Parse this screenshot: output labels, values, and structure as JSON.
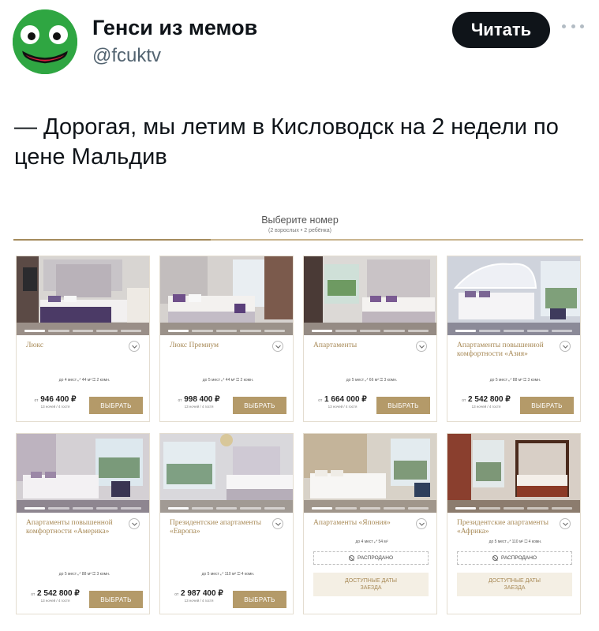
{
  "post": {
    "author_name": "Генси из мемов",
    "author_handle": "@fcuktv",
    "follow_label": "Читать",
    "text": "— Дорогая, мы летим в Кисловодск на 2 недели по цене Мальдив"
  },
  "booking": {
    "title": "Выберите номер",
    "subtitle": "(2 взрослых • 2 ребёнка)",
    "select_label": "ВЫБРАТЬ",
    "sold_out_label": "РАСПРОДАНО",
    "dates_label_1": "ДОСТУПНЫЕ ДАТЫ",
    "dates_label_2": "ЗАЕЗДА",
    "rooms": [
      {
        "name": "Люкс",
        "features": "до 4 мест   ⤢ 44 м²   ◫ 2 комн.",
        "price": "946 400",
        "price_prefix": "от",
        "currency": "₽",
        "nights": "13 ночей / 4 гостя"
      },
      {
        "name": "Люкс Премиум",
        "features": "до 5 мест   ⤢ 44 м²   ◫ 2 комн.",
        "price": "998 400",
        "price_prefix": "от",
        "currency": "₽",
        "nights": "13 ночей / 4 гостя"
      },
      {
        "name": "Апартаменты",
        "features": "до 5 мест   ⤢ 66 м²   ◫ 3 комн.",
        "price": "1 664 000",
        "price_prefix": "от",
        "currency": "₽",
        "nights": "13 ночей / 4 гостя"
      },
      {
        "name": "Апартаменты повышенной комфортности «Азия»",
        "features": "до 5 мест   ⤢ 88 м²   ◫ 3 комн.",
        "price": "2 542 800",
        "price_prefix": "от",
        "currency": "₽",
        "nights": "13 ночей / 4 гостя"
      },
      {
        "name": "Апартаменты повышенной комфортности «Америка»",
        "features": "до 5 мест   ⤢ 88 м²   ◫ 3 комн.",
        "price": "2 542 800",
        "price_prefix": "от",
        "currency": "₽",
        "nights": "13 ночей / 4 гостя"
      },
      {
        "name": "Президентские апартаменты «Европа»",
        "features": "до 5 мест   ⤢ 110 м²   ◫ 4 комн.",
        "price": "2 987 400",
        "price_prefix": "от",
        "currency": "₽",
        "nights": "13 ночей / 4 гостя"
      },
      {
        "name": "Апартаменты «Япония»",
        "features": "до 4 мест   ⤢ 54 м²"
      },
      {
        "name": "Президентские апартаменты «Африка»",
        "features": "до 5 мест   ⤢ 110 м²   ◫ 4 комн."
      }
    ]
  },
  "colors": {
    "accent_gold": "#b49a69",
    "text_gold": "#a88a57",
    "avatar_green": "#2fa642",
    "follow_button": "#0f1419"
  },
  "icons": [
    "frog-face-avatar",
    "more-dots-icon",
    "chevron-down-icon",
    "ban-icon"
  ]
}
